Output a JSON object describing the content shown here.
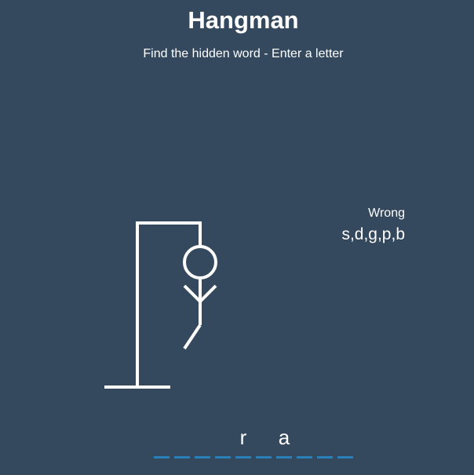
{
  "game": {
    "title": "Hangman",
    "subtitle": "Find the hidden word - Enter a letter"
  },
  "wrong": {
    "label": "Wrong",
    "letters": "s,d,g,p,b"
  },
  "word": {
    "letters": [
      "",
      "",
      "",
      "",
      "r",
      "",
      "a",
      "",
      "",
      ""
    ]
  },
  "figure": {
    "parts_shown": [
      "head",
      "body",
      "left-arm",
      "right-arm",
      "left-leg"
    ]
  },
  "colors": {
    "background": "#34495e",
    "stroke": "#ffffff",
    "underline": "#2980b9"
  }
}
